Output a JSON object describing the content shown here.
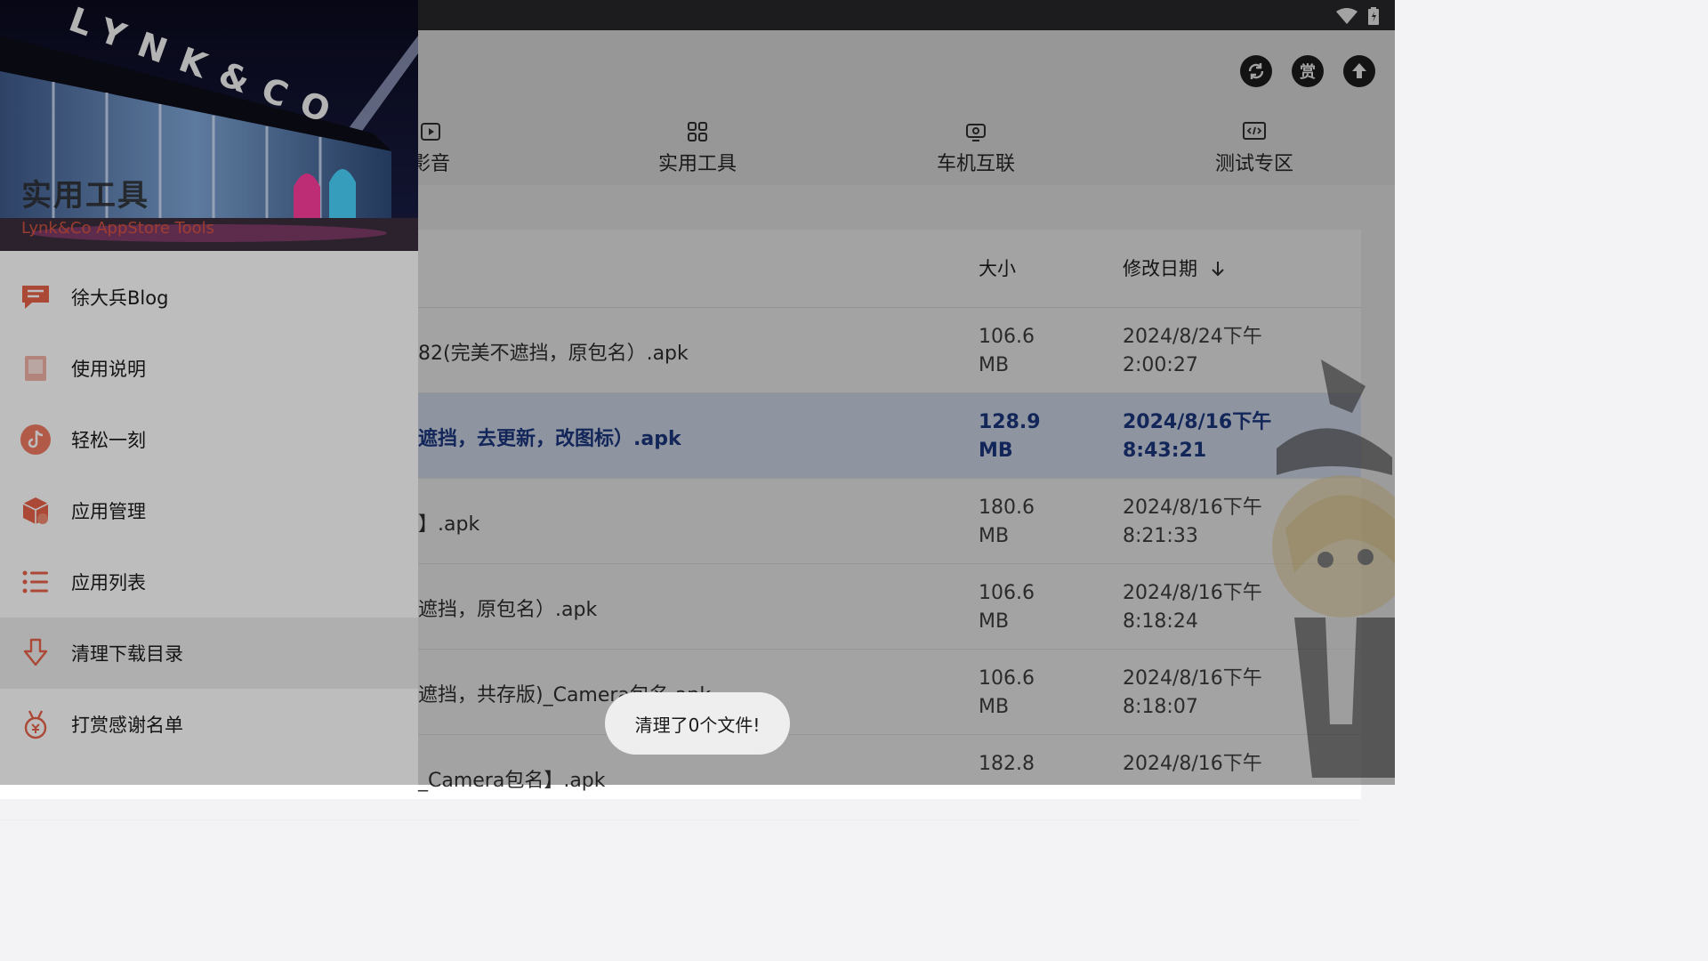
{
  "appbar": {
    "actions": [
      {
        "icon": "sync-icon"
      },
      {
        "label": "赏"
      },
      {
        "icon": "upload-icon"
      }
    ]
  },
  "tabs": [
    {
      "label": "影音",
      "icon": "media-icon"
    },
    {
      "label": "实用工具",
      "icon": "apps-grid-icon"
    },
    {
      "label": "车机互联",
      "icon": "car-connect-icon"
    },
    {
      "label": "测试专区",
      "icon": "code-icon"
    }
  ],
  "table": {
    "columns": {
      "size": "大小",
      "date": "修改日期"
    },
    "rows": [
      {
        "name": "82(完美不遮挡，原包名）.apk",
        "size": [
          "106.6",
          "MB"
        ],
        "date": [
          "2024/8/24下午",
          "2:00:27"
        ]
      },
      {
        "name": "遮挡，去更新，改图标）.apk",
        "size": [
          "128.9",
          "MB"
        ],
        "date": [
          "2024/8/16下午",
          "8:43:21"
        ],
        "selected": true
      },
      {
        "name": "】.apk",
        "size": [
          "180.6",
          "MB"
        ],
        "date": [
          "2024/8/16下午",
          "8:21:33"
        ]
      },
      {
        "name": "遮挡，原包名）.apk",
        "size": [
          "106.6",
          "MB"
        ],
        "date": [
          "2024/8/16下午",
          "8:18:24"
        ]
      },
      {
        "name": "遮挡，共存版)_Camera包名.apk",
        "size": [
          "106.6",
          "MB"
        ],
        "date": [
          "2024/8/16下午",
          "8:18:07"
        ]
      },
      {
        "name": "_Camera包名】.apk",
        "size": [
          "182.8",
          ""
        ],
        "date": [
          "2024/8/16下午",
          ""
        ]
      }
    ]
  },
  "drawer": {
    "title": "实用工具",
    "subtitle": "Lynk&Co AppStore Tools",
    "logo_text": "LYNK&CO",
    "menu": [
      {
        "label": "徐大兵Blog",
        "icon": "chat-icon"
      },
      {
        "label": "使用说明",
        "icon": "book-icon"
      },
      {
        "label": "轻松一刻",
        "icon": "tiktok-icon"
      },
      {
        "label": "应用管理",
        "icon": "package-icon"
      },
      {
        "label": "应用列表",
        "icon": "list-icon"
      },
      {
        "label": "清理下载目录",
        "icon": "download-icon",
        "active": true
      },
      {
        "label": "打赏感谢名单",
        "icon": "medal-icon"
      }
    ]
  },
  "toast": "清理了0个文件!",
  "colors": {
    "accent": "#e8624a",
    "selected_text": "#1f3c8c",
    "selected_bg": "#dfe8fb"
  }
}
